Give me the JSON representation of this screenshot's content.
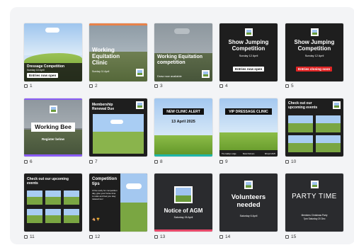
{
  "pages": [
    {
      "num": "1",
      "title": "Dressage Competition",
      "date": "Sunday 10 April",
      "button": "Entries now open"
    },
    {
      "num": "2",
      "title": "Working Equitation Clinic",
      "date": "Sunday 11 April"
    },
    {
      "num": "3",
      "title": "Working Equitation competition",
      "button": "Draw now available"
    },
    {
      "num": "4",
      "title": "Show Jumping Competition",
      "date": "Sunday 12 April",
      "button": "Entries now open"
    },
    {
      "num": "5",
      "title": "Show Jumping Competition",
      "date": "Sunday 12 April",
      "button": "Entries closing soon"
    },
    {
      "num": "6",
      "title": "Working Bee",
      "button": "Register below"
    },
    {
      "num": "7",
      "title": "Membership Renewal Due"
    },
    {
      "num": "8",
      "title": "NEW CLINIC ALERT",
      "date": "13 April 2025"
    },
    {
      "num": "9",
      "title": "VIP DRESSAGE CLINIC",
      "footer_left": "The Gallop Lodge",
      "footer_mid": "Book Partners",
      "footer_right": "08 April 2025"
    },
    {
      "num": "10",
      "title": "Check out our upcoming events"
    },
    {
      "num": "11",
      "title": "Check out our upcoming events"
    },
    {
      "num": "12",
      "title": "Competition tips",
      "body": "Arrive early for competition day, give your horse time to relax and feel you stay relaxed too!",
      "emoji": "🐴 🏆"
    },
    {
      "num": "13",
      "title": "Notice of AGM",
      "date": "Saturday 26 April"
    },
    {
      "num": "14",
      "title": "Volunteers needed",
      "date": "Saturday 6 April"
    },
    {
      "num": "15",
      "title": "PARTY TIME",
      "sub1": "Members Christmas Party",
      "sub2": "7pm Saturday 20 Dec"
    }
  ],
  "colors": {
    "accent_pink": "#e8496a",
    "accent_purple": "#8a5cf6",
    "accent_teal": "#1fb5a8",
    "accent_orange": "#e8824a",
    "button_red": "#e02424"
  },
  "icons": {
    "page": "page-icon"
  }
}
